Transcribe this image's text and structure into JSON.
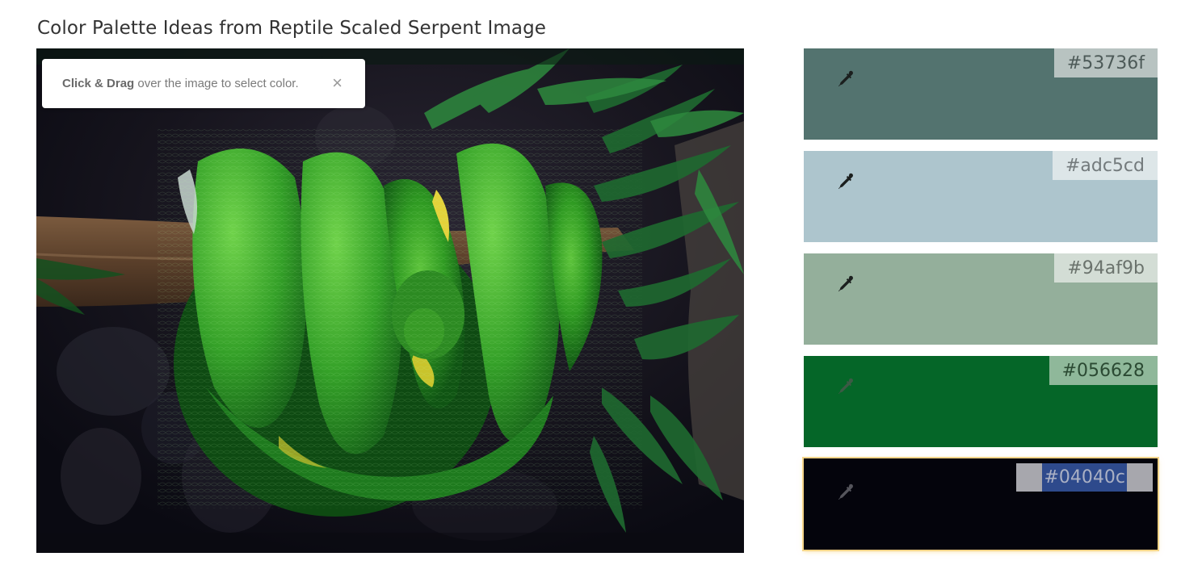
{
  "page": {
    "title": "Color Palette Ideas from Reptile Scaled Serpent Image"
  },
  "hint": {
    "strong": "Click & Drag",
    "text": " over the image to select color.",
    "close_glyph": "×"
  },
  "image": {
    "subject": "green tree python coiled on branch",
    "alt": ""
  },
  "swatches": [
    {
      "hex": "#53736f",
      "color": "#53736f",
      "label_bg": "#b8c3c1",
      "label_color": "#4d5a58"
    },
    {
      "hex": "#adc5cd",
      "color": "#adc5cd",
      "label_bg": "#dde6e8",
      "label_color": "#737a7c"
    },
    {
      "hex": "#94af9b",
      "color": "#94af9b",
      "label_bg": "#d3ddd5",
      "label_color": "#6b736d"
    },
    {
      "hex": "#056628",
      "color": "#056628",
      "label_bg": "#8fb89a",
      "label_color": "#2b4a33"
    },
    {
      "hex": "#04040c",
      "color": "#04040c",
      "selected": true
    }
  ],
  "icons": {
    "picker": "eyedropper-icon",
    "close": "close-icon"
  }
}
